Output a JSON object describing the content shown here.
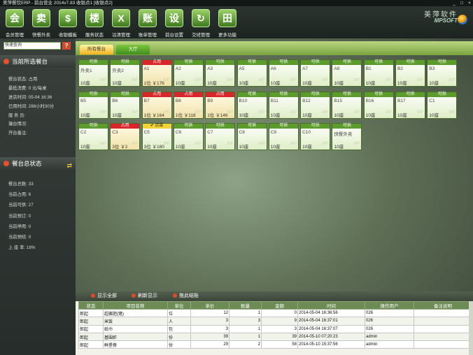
{
  "window": {
    "title": "美萍餐饮ERP - 前台营业 2014v7.83    收银点1 [收银点2]",
    "controls": [
      "_",
      "□",
      "×"
    ]
  },
  "toolbar": [
    {
      "label": "会员管理",
      "icon": "member-icon",
      "glyph": "会"
    },
    {
      "label": "快餐外卖",
      "icon": "cart-icon",
      "glyph": "卖"
    },
    {
      "label": "收银模板",
      "icon": "dollar-icon",
      "glyph": "$"
    },
    {
      "label": "服务状态",
      "icon": "building-icon",
      "glyph": "楼"
    },
    {
      "label": "沽清管理",
      "icon": "clear-icon",
      "glyph": "X"
    },
    {
      "label": "账单管理",
      "icon": "bill-icon",
      "glyph": "账"
    },
    {
      "label": "前台设置",
      "icon": "gear-icon",
      "glyph": "设"
    },
    {
      "label": "交班管理",
      "icon": "refresh-icon",
      "glyph": "↻"
    },
    {
      "label": "更多功能",
      "icon": "grid-icon",
      "glyph": "田"
    }
  ],
  "brand": {
    "cn": "美萍软件",
    "en": "MPSOFT"
  },
  "search": {
    "placeholder": "快速查询",
    "button": "?"
  },
  "current_table": {
    "title": "当前所选餐台",
    "rows": [
      "餐台状态: 占用",
      "最低消费: 0 元/每桌",
      "进店时间: 05-04 16:36",
      "已用时间: 288小时30分",
      "服 务 员:",
      "操台情况:",
      "开台备注:"
    ]
  },
  "overall": {
    "title": "餐台总状态",
    "rows": [
      "餐台总数: 33",
      "当前占用: 6",
      "当前可供: 27",
      "当前预订: 0",
      "当前停用: 0",
      "当前预结: 0",
      "上 座 率: 18%"
    ]
  },
  "tabs": [
    {
      "label": "所有餐台",
      "active": true
    },
    {
      "label": "大厅",
      "active": false
    }
  ],
  "tables": [
    {
      "status": "可供",
      "name": "外卖1",
      "bottom": "10座",
      "state": "free"
    },
    {
      "status": "可供",
      "name": "外卖2",
      "bottom": "10座",
      "state": "free"
    },
    {
      "status": "占用",
      "name": "A1",
      "bottom": "1位 ￥176",
      "state": "busy"
    },
    {
      "status": "可供",
      "name": "A2",
      "bottom": "10座",
      "state": "free"
    },
    {
      "status": "可供",
      "name": "A3",
      "bottom": "10座",
      "state": "free"
    },
    {
      "status": "可供",
      "name": "A5",
      "bottom": "10座",
      "state": "free"
    },
    {
      "status": "可供",
      "name": "A6",
      "bottom": "10座",
      "state": "free"
    },
    {
      "status": "可供",
      "name": "A7",
      "bottom": "10座",
      "state": "free"
    },
    {
      "status": "可供",
      "name": "A8",
      "bottom": "10座",
      "state": "free"
    },
    {
      "status": "可供",
      "name": "B1",
      "bottom": "10座",
      "state": "free"
    },
    {
      "status": "可供",
      "name": "B2",
      "bottom": "10座",
      "state": "free"
    },
    {
      "status": "可供",
      "name": "B3",
      "bottom": "10座",
      "state": "free"
    },
    {
      "status": "可供",
      "name": "B5",
      "bottom": "10座",
      "state": "free"
    },
    {
      "status": "可供",
      "name": "B6",
      "bottom": "10座",
      "state": "free"
    },
    {
      "status": "占用",
      "name": "B7",
      "bottom": "1位 ￥164",
      "state": "busy"
    },
    {
      "status": "占用",
      "name": "B8",
      "bottom": "1位 ￥118",
      "state": "busy"
    },
    {
      "status": "占用",
      "name": "B9",
      "bottom": "1位 ￥146",
      "state": "busy"
    },
    {
      "status": "可供",
      "name": "B10",
      "bottom": "10座",
      "state": "free"
    },
    {
      "status": "可供",
      "name": "B11",
      "bottom": "10座",
      "state": "free"
    },
    {
      "status": "可供",
      "name": "B12",
      "bottom": "10座",
      "state": "free"
    },
    {
      "status": "可供",
      "name": "B15",
      "bottom": "10座",
      "state": "free"
    },
    {
      "status": "可供",
      "name": "B16",
      "bottom": "10座",
      "state": "free"
    },
    {
      "status": "可供",
      "name": "B17",
      "bottom": "10座",
      "state": "free"
    },
    {
      "status": "可供",
      "name": "C1",
      "bottom": "10座",
      "state": "free"
    },
    {
      "status": "可供",
      "name": "C2",
      "bottom": "10座",
      "state": "free"
    },
    {
      "status": "占用",
      "name": "C3",
      "bottom": "3位 ￥2",
      "state": "busy"
    },
    {
      "status": "✔ 点菜",
      "name": "C5",
      "bottom": "3位 ￥180",
      "state": "pay"
    },
    {
      "status": "可供",
      "name": "C6",
      "bottom": "10座",
      "state": "free"
    },
    {
      "status": "可供",
      "name": "C7",
      "bottom": "10座",
      "state": "free"
    },
    {
      "status": "可供",
      "name": "C8",
      "bottom": "10座",
      "state": "free"
    },
    {
      "status": "可供",
      "name": "C9",
      "bottom": "10座",
      "state": "free"
    },
    {
      "status": "可供",
      "name": "C10",
      "bottom": "10座",
      "state": "free"
    },
    {
      "status": "可供",
      "name": "快餐外卖",
      "bottom": "10座",
      "state": "free"
    }
  ],
  "watermark": "MP",
  "actions": [
    "显示全部",
    "刷新显示",
    "拖此结账"
  ],
  "order_table": {
    "columns": [
      "状态",
      "项目名称",
      "单位",
      "单价",
      "数量",
      "金额",
      "时间",
      "操作用户",
      "备注说明"
    ],
    "rows": [
      [
        "郎起",
        "超酱肥(猪)",
        "位",
        "12",
        "1",
        "0",
        "2014-05-04 16:36:56",
        "026",
        ""
      ],
      [
        "郎起",
        "米饭",
        "人",
        "3",
        "3",
        "9",
        "2014-05-04 16:37:01",
        "026",
        ""
      ],
      [
        "郎起",
        "纸巾",
        "包",
        "3",
        "1",
        "3",
        "2014-05-04 16:37:07",
        "026",
        ""
      ],
      [
        "郎起",
        "基围虾",
        "份",
        "39",
        "1",
        "39",
        "2014-05-10 07:20:23",
        "admin",
        ""
      ],
      [
        "郎起",
        "鲜堡脊",
        "份",
        "29",
        "2",
        "58",
        "2014-05-10 15:37:56",
        "admin",
        ""
      ]
    ]
  }
}
